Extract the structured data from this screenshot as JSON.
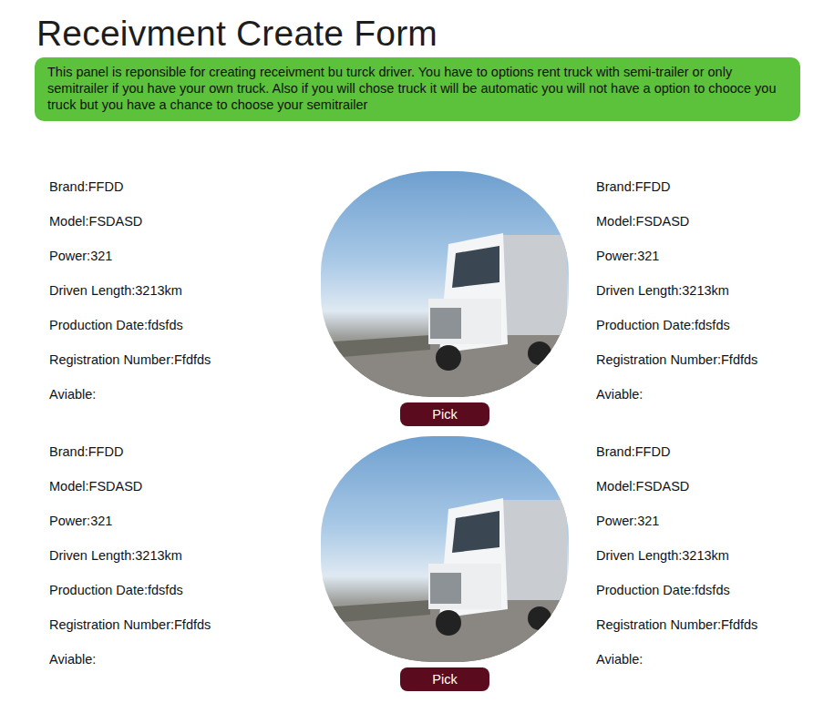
{
  "title": "Receivment Create Form",
  "info": "This panel is reponsible for creating receivment bu turck driver. You have to options rent truck with semi-trailer or only semitrailer if you have your own truck. Also if you will chose truck it will be automatic you will not have a option to chooce you truck but you have a chance to choose your semitrailer",
  "trucks": [
    {
      "left": [
        "Brand:FFDD",
        "Model:FSDASD",
        "Power:321",
        "Driven Length:3213km",
        "Production Date:fdsfds",
        "Registration Number:Ffdfds",
        "Aviable:"
      ],
      "right": [
        "Brand:FFDD",
        "Model:FSDASD",
        "Power:321",
        "Driven Length:3213km",
        "Production Date:fdsfds",
        "Registration Number:Ffdfds",
        "Aviable:"
      ],
      "button": "Pick"
    },
    {
      "left": [
        "Brand:FFDD",
        "Model:FSDASD",
        "Power:321",
        "Driven Length:3213km",
        "Production Date:fdsfds",
        "Registration Number:Ffdfds",
        "Aviable:"
      ],
      "right": [
        "Brand:FFDD",
        "Model:FSDASD",
        "Power:321",
        "Driven Length:3213km",
        "Production Date:fdsfds",
        "Registration Number:Ffdfds",
        "Aviable:"
      ],
      "button": "Pick"
    }
  ]
}
